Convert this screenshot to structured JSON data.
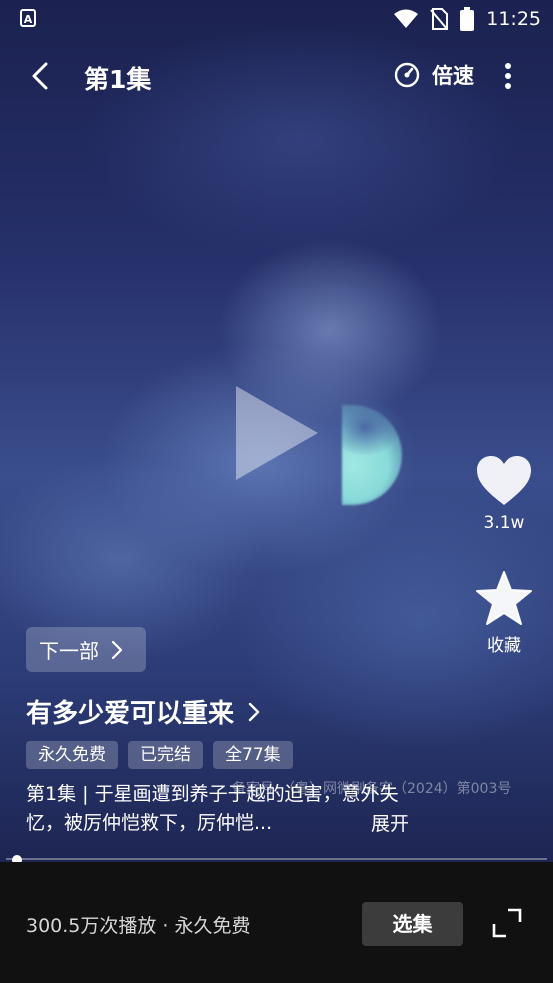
{
  "status_bar": {
    "time": "11:25"
  },
  "top_bar": {
    "title": "第1集",
    "speed_label": "倍速"
  },
  "actions": {
    "like_count": "3.1w",
    "favorite_label": "收藏"
  },
  "next_part": {
    "label": "下一部"
  },
  "drama": {
    "title": "有多少爱可以重来",
    "tags": [
      "永久免费",
      "已完结",
      "全77集"
    ],
    "license": "备案号：（粤）网微剧备字（2024）第003号",
    "description": "第1集 | 于星画遭到养子于越的迫害，意外失忆，被厉仲恺救下，厉仲恺...",
    "expand_label": "展开"
  },
  "playback": {
    "progress": 0.02
  },
  "bottom_bar": {
    "plays": "300.5万次播放 · 永久免费",
    "episodes_label": "选集"
  }
}
